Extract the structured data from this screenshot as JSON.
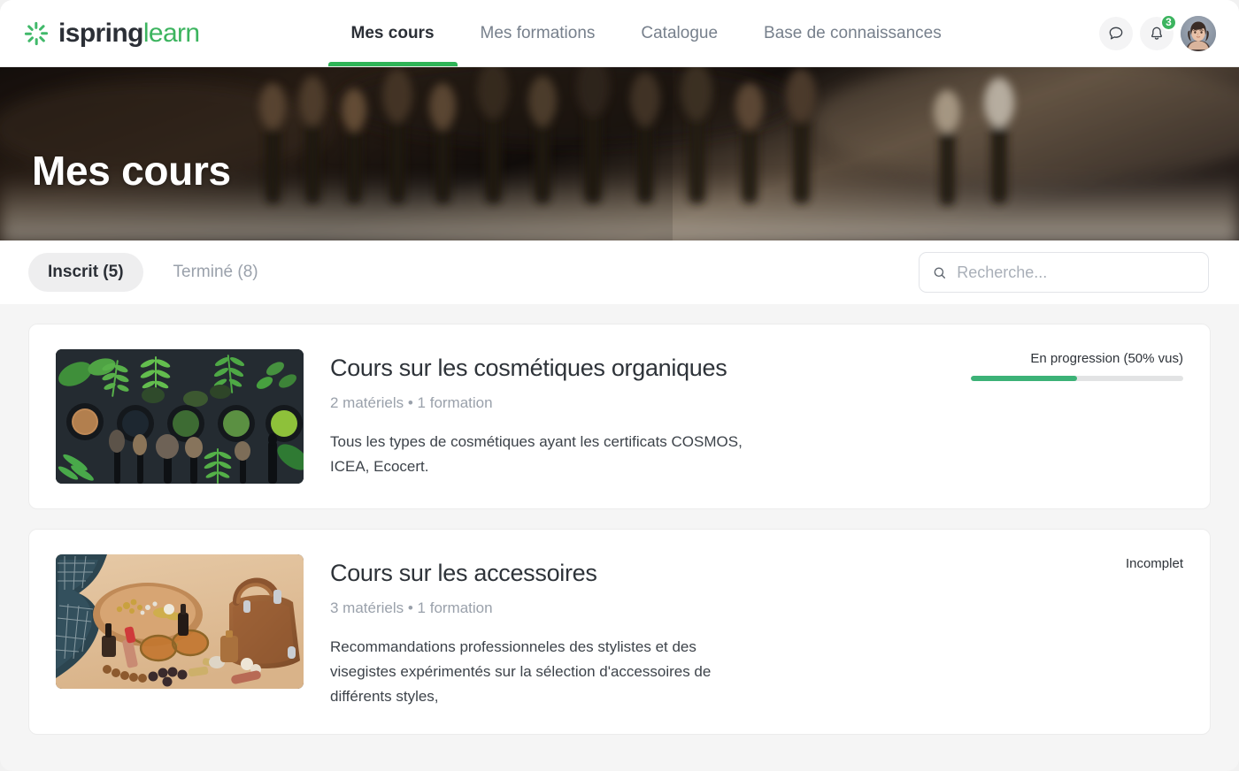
{
  "header": {
    "logo": {
      "name_part1": "ispring",
      "name_part2": "learn",
      "icon": "starburst-icon"
    },
    "nav": [
      {
        "label": "Mes cours",
        "active": true
      },
      {
        "label": "Mes formations",
        "active": false
      },
      {
        "label": "Catalogue",
        "active": false
      },
      {
        "label": "Base de connaissances",
        "active": false
      }
    ],
    "chat_icon": "chat-bubble-icon",
    "notifications_icon": "bell-icon",
    "notifications_count": "3",
    "avatar_icon": "user-avatar"
  },
  "hero": {
    "title": "Mes cours"
  },
  "tabs": [
    {
      "label": "Inscrit (5)",
      "active": true
    },
    {
      "label": "Terminé (8)",
      "active": false
    }
  ],
  "search": {
    "placeholder": "Recherche...",
    "value": "",
    "icon": "search-icon"
  },
  "courses": [
    {
      "title": "Cours sur les cosmétiques organiques",
      "meta": "2 matériels • 1 formation",
      "description": "Tous les types de cosmétiques ayant les certificats COSMOS, ICEA, Ecocert.",
      "status": "En progression (50% vus)",
      "progress_percent": 50,
      "has_progress_bar": true,
      "thumbnail": "organic-cosmetics-thumbnail"
    },
    {
      "title": "Cours sur les accessoires",
      "meta": "3 matériels • 1 formation",
      "description": "Recommandations professionneles des stylistes et des visegistes expérimentés sur la sélection d'accessoires de différents styles,",
      "status": "Incomplet",
      "progress_percent": 0,
      "has_progress_bar": false,
      "thumbnail": "accessories-thumbnail"
    }
  ],
  "colors": {
    "brand_green": "#3cb45f",
    "accent_green": "#2fb457",
    "progress_green": "#3cb277",
    "text_dark": "#2e3339",
    "text_muted": "#9aa1ab",
    "page_bg": "#f5f5f5"
  }
}
